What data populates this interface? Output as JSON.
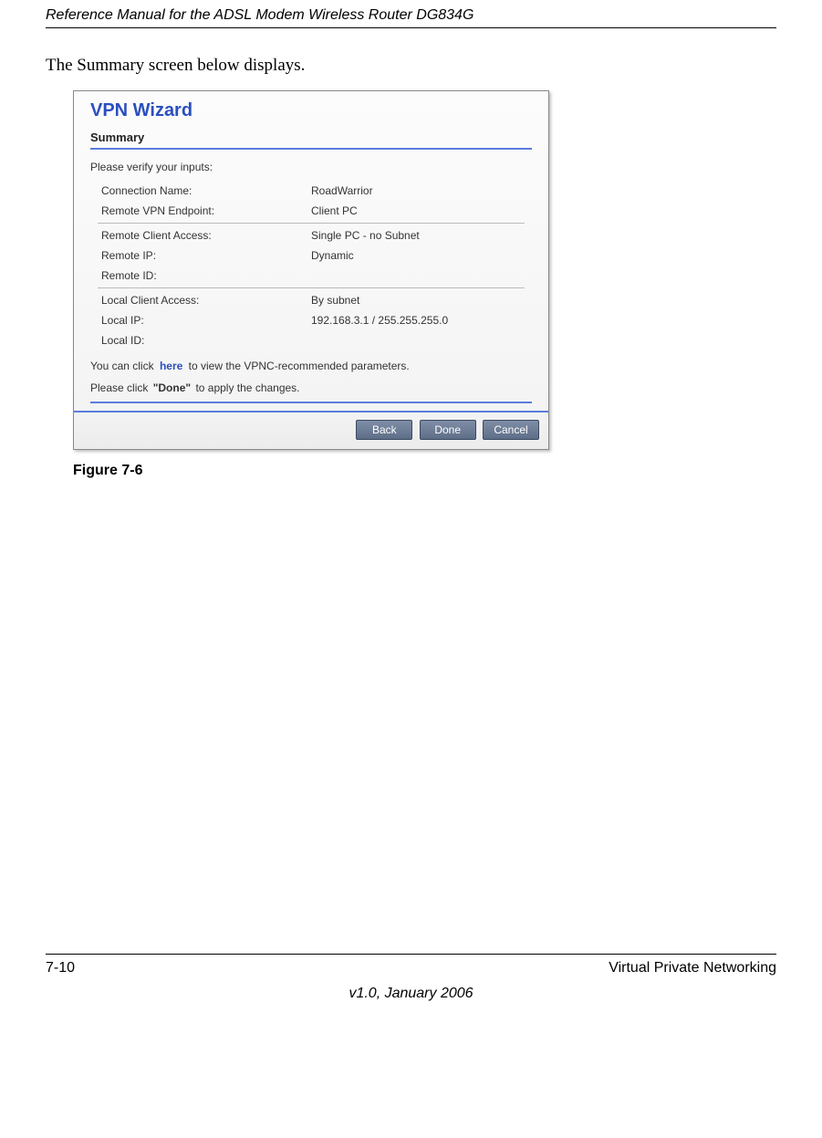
{
  "header": {
    "text": "Reference Manual for the ADSL Modem Wireless Router DG834G"
  },
  "intro_text": "The Summary screen below displays.",
  "wizard": {
    "title": "VPN Wizard",
    "section": "Summary",
    "verify_label": "Please verify your inputs:",
    "rows": [
      {
        "key": "Connection Name:",
        "value": "RoadWarrior"
      },
      {
        "key": "Remote VPN Endpoint:",
        "value": "Client PC"
      },
      {
        "sep": true
      },
      {
        "key": "Remote Client Access:",
        "value": "Single PC - no Subnet"
      },
      {
        "key": "Remote IP:",
        "value": "Dynamic"
      },
      {
        "key": "Remote ID:",
        "value": ""
      },
      {
        "sep": true
      },
      {
        "key": "Local Client Access:",
        "value": "By subnet"
      },
      {
        "key": "Local IP:",
        "value": "192.168.3.1 / 255.255.255.0"
      },
      {
        "key": "Local ID:",
        "value": ""
      }
    ],
    "hint1_pre": "You can click",
    "hint1_link": "here",
    "hint1_post": "to view the VPNC-recommended parameters.",
    "hint2_pre": "Please click",
    "hint2_bold": "\"Done\"",
    "hint2_post": "to apply the changes.",
    "buttons": {
      "back": "Back",
      "done": "Done",
      "cancel": "Cancel"
    }
  },
  "figure_label": "Figure 7-6",
  "footer": {
    "page": "7-10",
    "section": "Virtual Private Networking",
    "version": "v1.0, January 2006"
  }
}
